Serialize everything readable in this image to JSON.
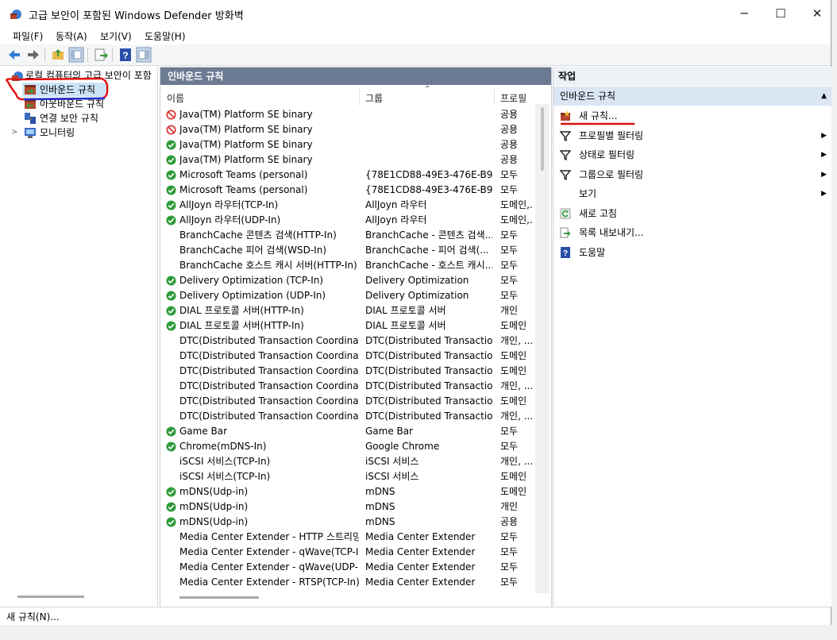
{
  "window": {
    "title": "고급 보안이 포함된 Windows Defender 방화벽",
    "minimize_glyph": "─",
    "maximize_glyph": "☐",
    "close_glyph": "✕"
  },
  "menu": [
    "파일(F)",
    "동작(A)",
    "보기(V)",
    "도움말(H)"
  ],
  "toolbar": {
    "icons": [
      "back-arrow-icon",
      "forward-arrow-icon",
      "up-folder-icon",
      "show-hide-tree-icon",
      "export-icon",
      "help-icon",
      "show-hide-action-pane-icon"
    ]
  },
  "tree": {
    "root": "로컬 컴퓨터의 고급 보안이 포함",
    "items": [
      {
        "label": "인바운드 규칙",
        "selected": true
      },
      {
        "label": "아웃바운드 규칙"
      },
      {
        "label": "연결 보안 규칙"
      },
      {
        "label": "모니터링"
      }
    ]
  },
  "center": {
    "header": "인바운드 규칙",
    "columns": {
      "name": "이름",
      "group": "그룹",
      "profile": "프로필"
    },
    "rows": [
      {
        "status": "blocked",
        "name": "Java(TM) Platform SE binary",
        "group": "",
        "profile": "공용"
      },
      {
        "status": "blocked",
        "name": "Java(TM) Platform SE binary",
        "group": "",
        "profile": "공용"
      },
      {
        "status": "allowed",
        "name": "Java(TM) Platform SE binary",
        "group": "",
        "profile": "공용"
      },
      {
        "status": "allowed",
        "name": "Java(TM) Platform SE binary",
        "group": "",
        "profile": "공용"
      },
      {
        "status": "allowed",
        "name": "Microsoft Teams (personal)",
        "group": "{78E1CD88-49E3-476E-B9...",
        "profile": "모두"
      },
      {
        "status": "allowed",
        "name": "Microsoft Teams (personal)",
        "group": "{78E1CD88-49E3-476E-B9...",
        "profile": "모두"
      },
      {
        "status": "allowed",
        "name": "AllJoyn 라우터(TCP-In)",
        "group": "AllJoyn 라우터",
        "profile": "도메인,..."
      },
      {
        "status": "allowed",
        "name": "AllJoyn 라우터(UDP-In)",
        "group": "AllJoyn 라우터",
        "profile": "도메인,..."
      },
      {
        "status": "none",
        "name": "BranchCache 콘텐츠 검색(HTTP-In)",
        "group": "BranchCache - 콘텐츠 검색...",
        "profile": "모두"
      },
      {
        "status": "none",
        "name": "BranchCache 피어 검색(WSD-In)",
        "group": "BranchCache - 피어 검색(...",
        "profile": "모두"
      },
      {
        "status": "none",
        "name": "BranchCache 호스트 캐시 서버(HTTP-In)",
        "group": "BranchCache - 호스트 캐시...",
        "profile": "모두"
      },
      {
        "status": "allowed",
        "name": "Delivery Optimization (TCP-In)",
        "group": "Delivery Optimization",
        "profile": "모두"
      },
      {
        "status": "allowed",
        "name": "Delivery Optimization (UDP-In)",
        "group": "Delivery Optimization",
        "profile": "모두"
      },
      {
        "status": "allowed",
        "name": "DIAL 프로토콜 서버(HTTP-In)",
        "group": "DIAL 프로토콜 서버",
        "profile": "개인"
      },
      {
        "status": "allowed",
        "name": "DIAL 프로토콜 서버(HTTP-In)",
        "group": "DIAL 프로토콜 서버",
        "profile": "도메인"
      },
      {
        "status": "none",
        "name": "DTC(Distributed Transaction Coordinato...",
        "group": "DTC(Distributed Transactio...",
        "profile": "개인, ..."
      },
      {
        "status": "none",
        "name": "DTC(Distributed Transaction Coordinato...",
        "group": "DTC(Distributed Transactio...",
        "profile": "도메인"
      },
      {
        "status": "none",
        "name": "DTC(Distributed Transaction Coordinato...",
        "group": "DTC(Distributed Transactio...",
        "profile": "도메인"
      },
      {
        "status": "none",
        "name": "DTC(Distributed Transaction Coordinato...",
        "group": "DTC(Distributed Transactio...",
        "profile": "개인, ..."
      },
      {
        "status": "none",
        "name": "DTC(Distributed Transaction Coordinato...",
        "group": "DTC(Distributed Transactio...",
        "profile": "도메인"
      },
      {
        "status": "none",
        "name": "DTC(Distributed Transaction Coordinato...",
        "group": "DTC(Distributed Transactio...",
        "profile": "개인, ..."
      },
      {
        "status": "allowed",
        "name": "Game Bar",
        "group": "Game Bar",
        "profile": "모두"
      },
      {
        "status": "allowed",
        "name": "Chrome(mDNS-In)",
        "group": "Google Chrome",
        "profile": "모두"
      },
      {
        "status": "none",
        "name": "iSCSI 서비스(TCP-In)",
        "group": "iSCSI 서비스",
        "profile": "개인, ..."
      },
      {
        "status": "none",
        "name": "iSCSI 서비스(TCP-In)",
        "group": "iSCSI 서비스",
        "profile": "도메인"
      },
      {
        "status": "allowed",
        "name": "mDNS(Udp-in)",
        "group": "mDNS",
        "profile": "도메인"
      },
      {
        "status": "allowed",
        "name": "mDNS(Udp-in)",
        "group": "mDNS",
        "profile": "개인"
      },
      {
        "status": "allowed",
        "name": "mDNS(Udp-in)",
        "group": "mDNS",
        "profile": "공용"
      },
      {
        "status": "none",
        "name": "Media Center Extender - HTTP 스트리밍...",
        "group": "Media Center Extender",
        "profile": "모두"
      },
      {
        "status": "none",
        "name": "Media Center Extender - qWave(TCP-In)",
        "group": "Media Center Extender",
        "profile": "모두"
      },
      {
        "status": "none",
        "name": "Media Center Extender - qWave(UDP-In)",
        "group": "Media Center Extender",
        "profile": "모두"
      },
      {
        "status": "none",
        "name": "Media Center Extender - RTSP(TCP-In)",
        "group": "Media Center Extender",
        "profile": "모두"
      }
    ]
  },
  "actions": {
    "header": "작업",
    "section": "인바운드 규칙",
    "section_toggle": "▲",
    "items": [
      {
        "label": "새 규칙...",
        "icon": "new-rule-icon",
        "submenu": false
      },
      {
        "label": "프로필별 필터링",
        "icon": "filter-icon",
        "submenu": true
      },
      {
        "label": "상태로 필터링",
        "icon": "filter-icon",
        "submenu": true
      },
      {
        "label": "그룹으로 필터링",
        "icon": "filter-icon",
        "submenu": true
      },
      {
        "label": "보기",
        "icon": "",
        "submenu": true
      },
      {
        "label": "새로 고침",
        "icon": "refresh-icon",
        "submenu": false
      },
      {
        "label": "목록 내보내기...",
        "icon": "export-list-icon",
        "submenu": false
      },
      {
        "label": "도움말",
        "icon": "help-icon",
        "submenu": false
      }
    ],
    "submenu_glyph": "▶"
  },
  "statusbar": {
    "text": "새 규칙(N)..."
  },
  "colors": {
    "allowed": "#2e9b3a",
    "blocked": "#d9302c",
    "annotation": "#e01010",
    "header_bg": "#6b7b93",
    "section_bg": "#dbe6f4"
  }
}
